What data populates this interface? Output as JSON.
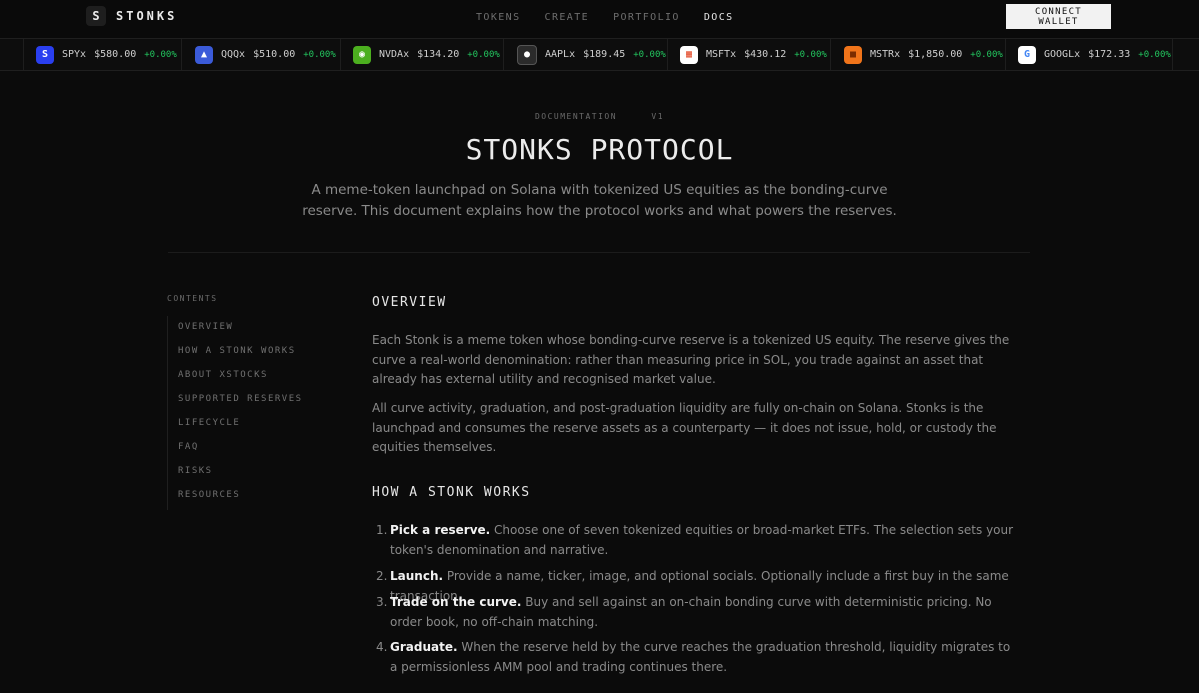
{
  "nav": {
    "logo_mark": "S",
    "logo_text": "STONKS",
    "menu": [
      "TOKENS",
      "CREATE",
      "PORTFOLIO",
      "DOCS"
    ],
    "active": "DOCS",
    "connect_label": "CONNECT WALLET"
  },
  "ticker": [
    {
      "name": "SPYx",
      "price": "$580.00",
      "change": "+0.00%",
      "color": "#2a3ff0",
      "glyph": "S"
    },
    {
      "name": "QQQx",
      "price": "$510.00",
      "change": "+0.00%",
      "color": "#3b5bd9",
      "glyph": "▲"
    },
    {
      "name": "NVDAx",
      "price": "$134.20",
      "change": "+0.00%",
      "color": "#4caf1f",
      "glyph": "◉"
    },
    {
      "name": "AAPLx",
      "price": "$189.45",
      "change": "+0.00%",
      "color": "#2b2b2b",
      "glyph": "●"
    },
    {
      "name": "MSFTx",
      "price": "$430.12",
      "change": "+0.00%",
      "color": "#ffffff",
      "glyph": "▦"
    },
    {
      "name": "MSTRx",
      "price": "$1,850.00",
      "change": "+0.00%",
      "color": "#f0741a",
      "glyph": "■"
    },
    {
      "name": "GOOGLx",
      "price": "$172.33",
      "change": "+0.00%",
      "color": "#ffffff",
      "glyph": "G"
    }
  ],
  "hero": {
    "eyebrow_left": "DOCUMENTATION",
    "eyebrow_right": "V1",
    "title": "STONKS PROTOCOL",
    "subtitle": "A meme-token launchpad on Solana with tokenized US equities as the bonding-curve reserve. This document explains how the protocol works and what powers the reserves."
  },
  "toc": {
    "label": "CONTENTS",
    "items": [
      "OVERVIEW",
      "HOW A STONK WORKS",
      "ABOUT XSTOCKS",
      "SUPPORTED RESERVES",
      "LIFECYCLE",
      "FAQ",
      "RISKS",
      "RESOURCES"
    ]
  },
  "overview": {
    "heading": "OVERVIEW",
    "p1": "Each Stonk is a meme token whose bonding-curve reserve is a tokenized US equity. The reserve gives the curve a real-world denomination: rather than measuring price in SOL, you trade against an asset that already has external utility and recognised market value.",
    "p2": "All curve activity, graduation, and post-graduation liquidity are fully on-chain on Solana. Stonks is the launchpad and consumes the reserve assets as a counterparty — it does not issue, hold, or custody the equities themselves."
  },
  "how": {
    "heading": "HOW A STONK WORKS",
    "steps": [
      {
        "n": "1.",
        "title": "Pick a reserve.",
        "text": " Choose one of seven tokenized equities or broad-market ETFs. The selection sets your token's denomination and narrative."
      },
      {
        "n": "2.",
        "title": "Launch.",
        "text": " Provide a name, ticker, image, and optional socials. Optionally include a first buy in the same transaction."
      },
      {
        "n": "3.",
        "title": "Trade on the curve.",
        "text": " Buy and sell against an on-chain bonding curve with deterministic pricing. No order book, no off-chain matching."
      },
      {
        "n": "4.",
        "title": "Graduate.",
        "text": " When the reserve held by the curve reaches the graduation threshold, liquidity migrates to a permissionless AMM pool and trading continues there."
      }
    ]
  }
}
